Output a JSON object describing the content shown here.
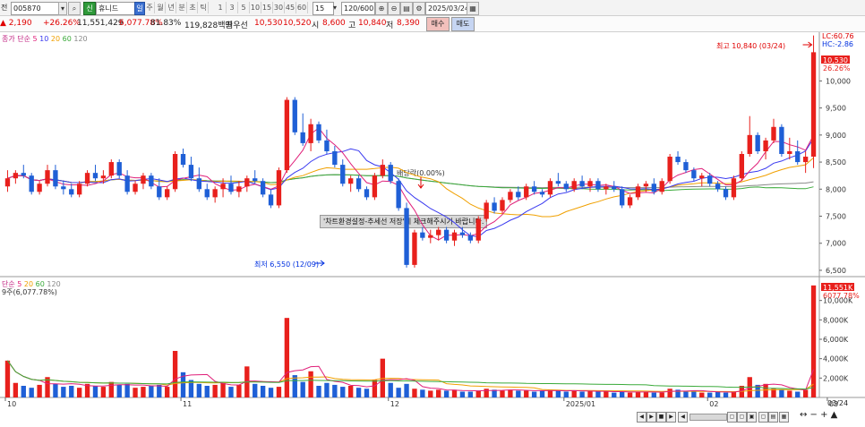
{
  "toolbar": {
    "mode_label": "전",
    "stock_code": "005870",
    "search_icon": "magnifier-icon",
    "market_badge": "신",
    "stock_name": "휴니드",
    "period_buttons": [
      "일",
      "주",
      "월",
      "년",
      "분",
      "초",
      "틱"
    ],
    "selected_period": "일",
    "interval_buttons": [
      "1",
      "3",
      "5",
      "10",
      "15",
      "30",
      "45",
      "60"
    ],
    "interval_value": "15",
    "count_value": "120/600",
    "date_value": "2025/03/24"
  },
  "quote": {
    "change": "▲ 2,190",
    "change_pct": "+26.26%",
    "volume": "11,551,429",
    "volume_ratio_pct": "6,077.78%",
    "turnover_pct": "81.83%",
    "amount": "119,828백만",
    "priority_label": "최우선",
    "ask": "10,530",
    "bid": "10,520",
    "open_label": "시",
    "open": "8,600",
    "high_label": "고",
    "high": "10,840",
    "low_label": "저",
    "low": "8,390",
    "buy_label": "매수",
    "sell_label": "매도"
  },
  "price_panel": {
    "legend": [
      "종가 단순",
      "5",
      "10",
      "20",
      "60",
      "120"
    ],
    "lc": "LC:60.76",
    "hc": "HC:-2.86",
    "last_price": "10,530",
    "last_pct": "26.26%",
    "high_note": "최고 10,840 (03/24)",
    "low_note": "최저 6,550 (12/09)",
    "dividend_note": "배당락(0.00%)",
    "notice": "'차트환경설정-추세선 저장'에 체크해주시기 바랍니다.",
    "y_ticks": [
      "10,000",
      "9,500",
      "9,000",
      "8,500",
      "8,000",
      "7,500",
      "7,000",
      "6,500"
    ]
  },
  "volume_panel": {
    "legend": [
      "단순",
      "5",
      "20",
      "60",
      "120"
    ],
    "sub_legend": "9주(6,077.78%)",
    "last_volume": "11,551K",
    "last_pct": "6077.78%",
    "y_ticks": [
      "10,000K",
      "8,000K",
      "6,000K",
      "4,000K",
      "2,000K"
    ]
  },
  "x_axis": {
    "labels": [
      "10",
      "11",
      "12",
      "2025/01",
      "02",
      "03"
    ],
    "right_label": "03/24"
  },
  "colors": {
    "up": "#e8201c",
    "down": "#1f5fd6",
    "ma5": "#e0207a",
    "ma10": "#3a3af0",
    "ma20": "#f0a000",
    "ma60": "#3aaa3a",
    "ma120": "#888888"
  },
  "chart_data": {
    "type": "candlestick",
    "x_range": [
      "2024/10",
      "2025/03/24"
    ],
    "price_ylim": [
      6400,
      10900
    ],
    "volume_ylim": [
      0,
      12000
    ],
    "volume_unit": "K",
    "series": [
      {
        "name": "price",
        "ohlc": [
          [
            8050,
            8350,
            7950,
            8200
          ],
          [
            8200,
            8350,
            8100,
            8300
          ],
          [
            8300,
            8450,
            8200,
            8250
          ],
          [
            8250,
            8300,
            7900,
            7950
          ],
          [
            7950,
            8150,
            7900,
            8100
          ],
          [
            8100,
            8450,
            8050,
            8350
          ],
          [
            8350,
            8450,
            8000,
            8050
          ],
          [
            8050,
            8150,
            7900,
            8000
          ],
          [
            8000,
            8100,
            7850,
            7900
          ],
          [
            7900,
            8150,
            7850,
            8100
          ],
          [
            8100,
            8350,
            8050,
            8300
          ],
          [
            8300,
            8450,
            8150,
            8200
          ],
          [
            8200,
            8350,
            8100,
            8250
          ],
          [
            8250,
            8550,
            8200,
            8500
          ],
          [
            8500,
            8550,
            8200,
            8250
          ],
          [
            8250,
            8350,
            7900,
            7950
          ],
          [
            7950,
            8150,
            7900,
            8100
          ],
          [
            8100,
            8300,
            8000,
            8250
          ],
          [
            8250,
            8300,
            8000,
            8050
          ],
          [
            8050,
            8200,
            7800,
            7850
          ],
          [
            7850,
            8050,
            7800,
            8000
          ],
          [
            8000,
            8700,
            7950,
            8650
          ],
          [
            8650,
            8750,
            8400,
            8450
          ],
          [
            8450,
            8600,
            8150,
            8200
          ],
          [
            8200,
            8400,
            7950,
            8000
          ],
          [
            8000,
            8100,
            7800,
            7850
          ],
          [
            7850,
            8050,
            7750,
            8000
          ],
          [
            8000,
            8200,
            7850,
            8100
          ],
          [
            8100,
            8250,
            7900,
            7950
          ],
          [
            7950,
            8150,
            7850,
            8050
          ],
          [
            8050,
            8250,
            7950,
            8200
          ],
          [
            8200,
            8350,
            8100,
            8150
          ],
          [
            8150,
            8200,
            7850,
            7900
          ],
          [
            7900,
            8000,
            7650,
            7700
          ],
          [
            7700,
            8400,
            7650,
            8350
          ],
          [
            8350,
            9700,
            8300,
            9650
          ],
          [
            9650,
            9700,
            9000,
            9050
          ],
          [
            9050,
            9400,
            8800,
            8850
          ],
          [
            8850,
            9300,
            8700,
            9200
          ],
          [
            9200,
            9250,
            8850,
            8900
          ],
          [
            8900,
            9100,
            8650,
            8700
          ],
          [
            8700,
            8800,
            8400,
            8450
          ],
          [
            8450,
            8550,
            8050,
            8100
          ],
          [
            8100,
            8250,
            7950,
            8200
          ],
          [
            8200,
            8250,
            7950,
            8000
          ],
          [
            8000,
            8050,
            7800,
            7850
          ],
          [
            7850,
            8300,
            7800,
            8250
          ],
          [
            8250,
            8550,
            8200,
            8450
          ],
          [
            8450,
            8500,
            8100,
            8150
          ],
          [
            8150,
            8200,
            7600,
            7650
          ],
          [
            7650,
            7750,
            6550,
            6600
          ],
          [
            6600,
            7250,
            6550,
            7200
          ],
          [
            7200,
            7300,
            7050,
            7100
          ],
          [
            7100,
            7250,
            7000,
            7150
          ],
          [
            7150,
            7300,
            7050,
            7250
          ],
          [
            7250,
            7300,
            7000,
            7050
          ],
          [
            7050,
            7250,
            6950,
            7200
          ],
          [
            7200,
            7300,
            7100,
            7150
          ],
          [
            7150,
            7200,
            7000,
            7050
          ],
          [
            7050,
            7500,
            7000,
            7450
          ],
          [
            7450,
            7800,
            7400,
            7750
          ],
          [
            7750,
            7850,
            7550,
            7600
          ],
          [
            7600,
            7850,
            7550,
            7800
          ],
          [
            7800,
            8000,
            7750,
            7950
          ],
          [
            7950,
            8050,
            7800,
            7850
          ],
          [
            7850,
            8100,
            7800,
            8050
          ],
          [
            8050,
            8150,
            7900,
            7950
          ],
          [
            7950,
            8000,
            7850,
            7900
          ],
          [
            7900,
            8200,
            7850,
            8150
          ],
          [
            8150,
            8300,
            8050,
            8100
          ],
          [
            8100,
            8150,
            7950,
            8000
          ],
          [
            8000,
            8200,
            7950,
            8150
          ],
          [
            8150,
            8250,
            8000,
            8050
          ],
          [
            8050,
            8200,
            7950,
            8150
          ],
          [
            8150,
            8200,
            7950,
            8000
          ],
          [
            8000,
            8100,
            7900,
            8050
          ],
          [
            8050,
            8150,
            7950,
            8000
          ],
          [
            8000,
            8050,
            7650,
            7700
          ],
          [
            7700,
            7900,
            7650,
            7850
          ],
          [
            7850,
            8100,
            7800,
            8050
          ],
          [
            8050,
            8150,
            7950,
            8100
          ],
          [
            8100,
            8200,
            7900,
            7950
          ],
          [
            7950,
            8200,
            7900,
            8150
          ],
          [
            8150,
            8650,
            8100,
            8600
          ],
          [
            8600,
            8700,
            8450,
            8500
          ],
          [
            8500,
            8550,
            8300,
            8350
          ],
          [
            8350,
            8400,
            8150,
            8200
          ],
          [
            8200,
            8300,
            8050,
            8250
          ],
          [
            8250,
            8300,
            8050,
            8100
          ],
          [
            8100,
            8150,
            7950,
            8000
          ],
          [
            8000,
            8050,
            7800,
            7850
          ],
          [
            7850,
            8250,
            7800,
            8200
          ],
          [
            8200,
            8700,
            8150,
            8650
          ],
          [
            8650,
            9350,
            8600,
            9000
          ],
          [
            9000,
            9050,
            8650,
            8700
          ],
          [
            8700,
            8950,
            8550,
            8900
          ],
          [
            8900,
            9300,
            8850,
            9150
          ],
          [
            9150,
            9200,
            8600,
            8650
          ],
          [
            8650,
            8950,
            8550,
            8700
          ],
          [
            8700,
            8900,
            8450,
            8500
          ],
          [
            8500,
            8700,
            8300,
            8600
          ],
          [
            8600,
            10840,
            8390,
            10530
          ]
        ]
      },
      {
        "name": "volume",
        "values": [
          3800,
          1500,
          1200,
          1000,
          1300,
          2100,
          1400,
          1100,
          1200,
          1000,
          1400,
          1200,
          1100,
          1600,
          1300,
          1400,
          1000,
          1100,
          1200,
          1300,
          1100,
          4800,
          2600,
          1800,
          1400,
          1200,
          1300,
          1500,
          1100,
          1300,
          3200,
          1400,
          1200,
          1000,
          1100,
          8200,
          2300,
          1600,
          2700,
          1200,
          1500,
          1300,
          1100,
          1200,
          1000,
          900,
          1800,
          4000,
          1500,
          1000,
          1400,
          900,
          800,
          700,
          800,
          700,
          800,
          600,
          600,
          700,
          900,
          800,
          700,
          800,
          700,
          700,
          600,
          700,
          800,
          700,
          600,
          700,
          600,
          700,
          600,
          600,
          500,
          600,
          500,
          600,
          600,
          500,
          500,
          900,
          800,
          600,
          700,
          500,
          500,
          600,
          500,
          600,
          1200,
          2100,
          1300,
          1400,
          900,
          800,
          700,
          600,
          800,
          11551
        ]
      }
    ]
  }
}
